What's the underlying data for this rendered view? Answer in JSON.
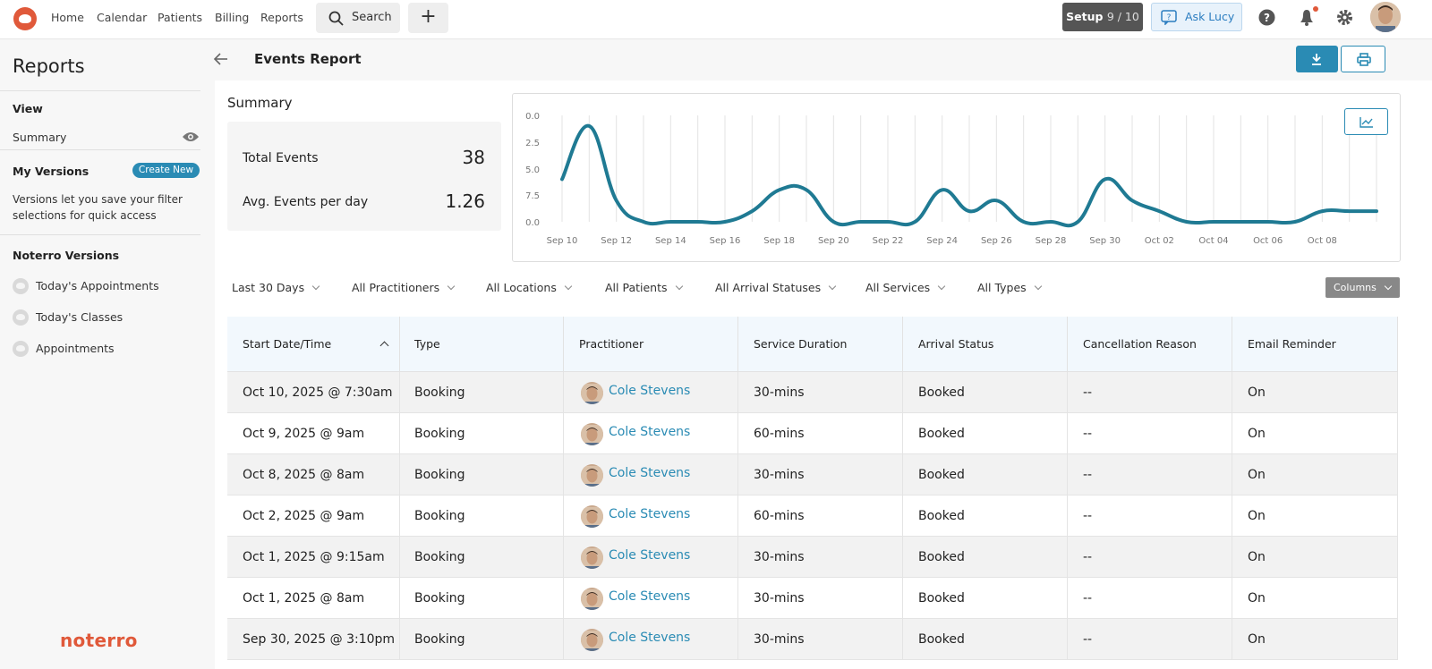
{
  "topnav": {
    "items": [
      "Home",
      "Calendar",
      "Patients",
      "Billing",
      "Reports"
    ],
    "search_label": "Search",
    "setup_label": "Setup",
    "setup_progress": "9 / 10",
    "ask_label": "Ask Lucy"
  },
  "sidebar": {
    "title": "Reports",
    "view_heading": "View",
    "summary_label": "Summary",
    "my_versions_heading": "My Versions",
    "create_new_label": "Create New",
    "versions_desc": "Versions let you save your filter selections for quick access",
    "noterro_versions_heading": "Noterro Versions",
    "noterro_items": [
      "Today's Appointments",
      "Today's Classes",
      "Appointments"
    ],
    "brand": "noterro"
  },
  "page": {
    "title": "Events Report"
  },
  "summary": {
    "title": "Summary",
    "total_events_label": "Total Events",
    "total_events_value": "38",
    "avg_label": "Avg. Events per day",
    "avg_value": "1.26"
  },
  "chart_data": {
    "type": "line",
    "x": [
      "Sep 10",
      "Sep 11",
      "Sep 12",
      "Sep 13",
      "Sep 14",
      "Sep 15",
      "Sep 16",
      "Sep 17",
      "Sep 18",
      "Sep 19",
      "Sep 20",
      "Sep 21",
      "Sep 22",
      "Sep 23",
      "Sep 24",
      "Sep 25",
      "Sep 26",
      "Sep 27",
      "Sep 28",
      "Sep 29",
      "Sep 30",
      "Oct 01",
      "Oct 02",
      "Oct 03",
      "Oct 04",
      "Oct 05",
      "Oct 06",
      "Oct 07",
      "Oct 08",
      "Oct 09",
      "Oct 10"
    ],
    "xticks": [
      "Sep 10",
      "Sep 12",
      "Sep 14",
      "Sep 16",
      "Sep 18",
      "Sep 20",
      "Sep 22",
      "Sep 24",
      "Sep 26",
      "Sep 28",
      "Sep 30",
      "Oct 02",
      "Oct 04",
      "Oct 06",
      "Oct 08"
    ],
    "yticks": [
      "0.0",
      "2.5",
      "5.0",
      "7.5",
      "0.0"
    ],
    "values": [
      4,
      9,
      2,
      0,
      0,
      0,
      0,
      1,
      3,
      3,
      0,
      0,
      0,
      0,
      3,
      1,
      2,
      0,
      0,
      0,
      4,
      2,
      1,
      0,
      0,
      0,
      0,
      0,
      1,
      1,
      1
    ],
    "ylim": [
      0,
      10
    ],
    "grid": true,
    "color": "#1f7a93"
  },
  "filters": [
    "Last 30 Days",
    "All Practitioners",
    "All Locations",
    "All Patients",
    "All Arrival Statuses",
    "All Services",
    "All Types"
  ],
  "columns_label": "Columns",
  "table": {
    "headers": [
      "Start Date/Time",
      "Type",
      "Practitioner",
      "Service Duration",
      "Arrival Status",
      "Cancellation Reason",
      "Email Reminder"
    ],
    "rows": [
      [
        "Oct 10, 2025 @ 7:30am",
        "Booking",
        "Cole Stevens",
        "30-mins",
        "Booked",
        "--",
        "On"
      ],
      [
        "Oct 9, 2025 @ 9am",
        "Booking",
        "Cole Stevens",
        "60-mins",
        "Booked",
        "--",
        "On"
      ],
      [
        "Oct 8, 2025 @ 8am",
        "Booking",
        "Cole Stevens",
        "30-mins",
        "Booked",
        "--",
        "On"
      ],
      [
        "Oct 2, 2025 @ 9am",
        "Booking",
        "Cole Stevens",
        "60-mins",
        "Booked",
        "--",
        "On"
      ],
      [
        "Oct 1, 2025 @ 9:15am",
        "Booking",
        "Cole Stevens",
        "30-mins",
        "Booked",
        "--",
        "On"
      ],
      [
        "Oct 1, 2025 @ 8am",
        "Booking",
        "Cole Stevens",
        "30-mins",
        "Booked",
        "--",
        "On"
      ],
      [
        "Sep 30, 2025 @ 3:10pm",
        "Booking",
        "Cole Stevens",
        "30-mins",
        "Booked",
        "--",
        "On"
      ]
    ]
  },
  "colors": {
    "accent": "#2a8bb4",
    "brand": "#e0593a"
  }
}
